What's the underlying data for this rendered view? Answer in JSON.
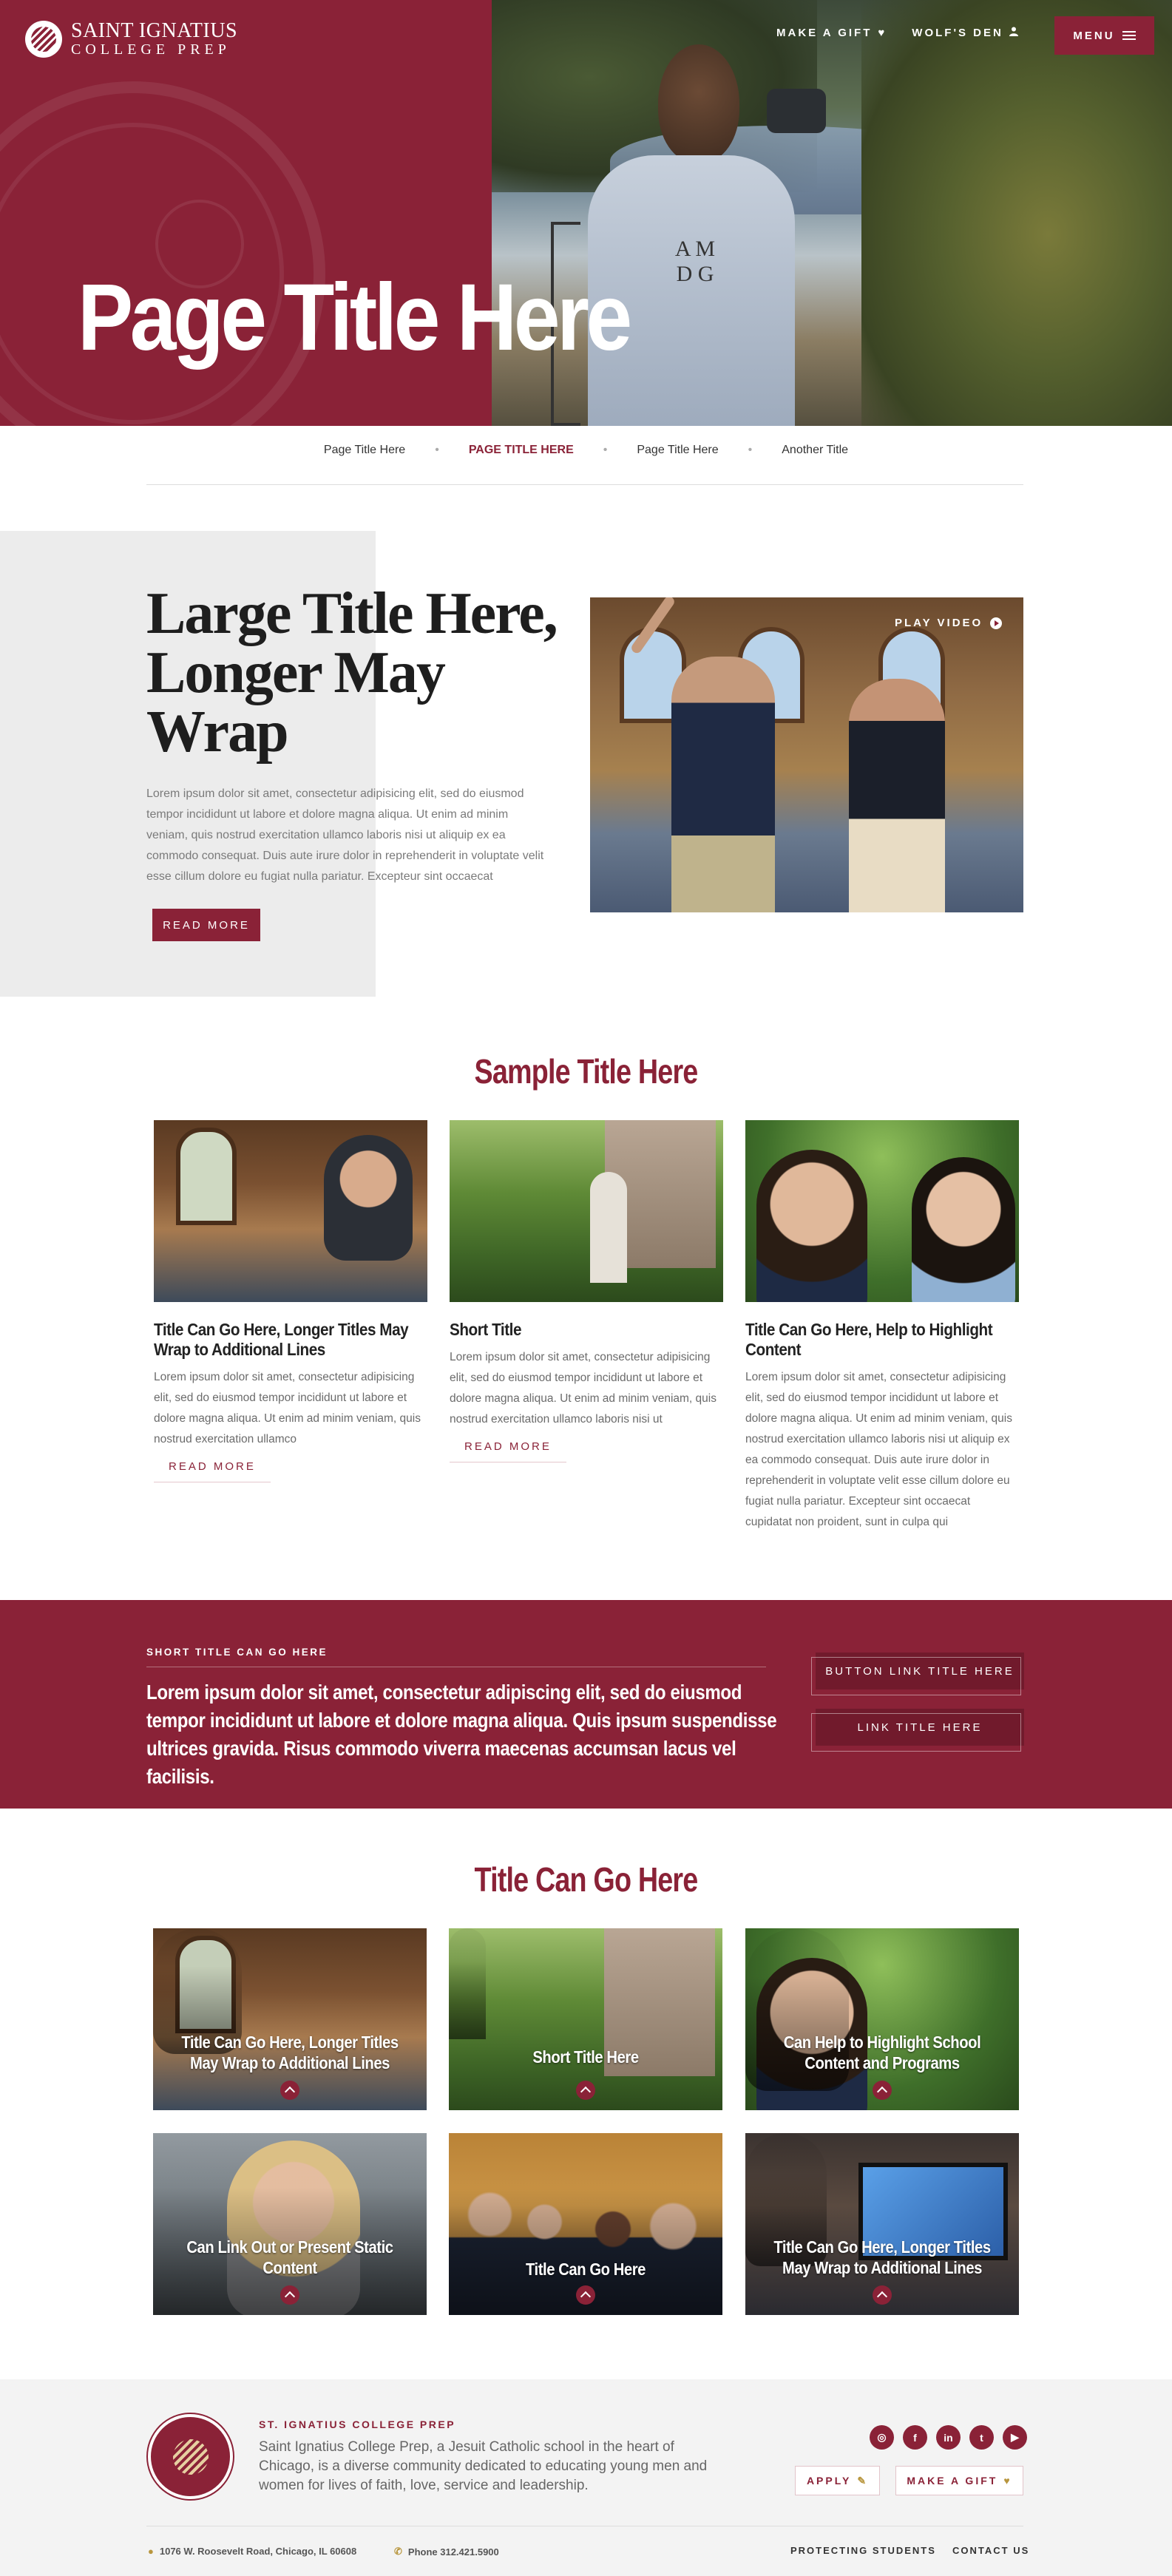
{
  "brand": {
    "line1": "SAINT IGNATIUS",
    "line2": "COLLEGE PREP",
    "accent": "#8a2237"
  },
  "top_nav": {
    "make_gift": "MAKE A GIFT",
    "make_gift_icon": "heart-icon",
    "wolfs_den": "WOLF'S DEN",
    "wolfs_den_icon": "user-icon",
    "menu": "MENU",
    "menu_icon": "hamburger-icon"
  },
  "hero": {
    "title": "Page Title Here",
    "shirt_text": "A M D G"
  },
  "breadcrumb": [
    {
      "label": "Page Title Here",
      "active": false
    },
    {
      "label": "PAGE TITLE HERE",
      "active": true
    },
    {
      "label": "Page Title Here",
      "active": false
    },
    {
      "label": "Another Title",
      "active": false
    }
  ],
  "intro": {
    "title": "Large Title Here, Longer May Wrap",
    "body": "Lorem ipsum dolor sit amet, consectetur adipisicing elit, sed do eiusmod tempor incididunt ut labore et dolore magna aliqua. Ut enim ad minim veniam, quis nostrud exercitation ullamco laboris nisi ut aliquip ex ea commodo consequat. Duis aute irure dolor in reprehenderit in voluptate velit esse cillum dolore eu fugiat nulla pariatur. Excepteur sint occaecat",
    "button": "READ MORE",
    "play_video": "PLAY VIDEO"
  },
  "sample_section": {
    "title": "Sample Title Here",
    "cards": [
      {
        "title": "Title Can Go Here, Longer Titles May Wrap to Additional Lines",
        "body": "Lorem ipsum dolor sit amet, consectetur adipisicing elit, sed do eiusmod tempor incididunt ut labore et dolore magna aliqua. Ut enim ad minim veniam, quis nostrud exercitation ullamco",
        "link": "READ MORE"
      },
      {
        "title": "Short Title",
        "body": "Lorem ipsum dolor sit amet, consectetur adipisicing elit, sed do eiusmod tempor incididunt ut labore et dolore magna aliqua. Ut enim ad minim veniam, quis nostrud exercitation ullamco laboris nisi ut",
        "link": "READ MORE"
      },
      {
        "title": "Title Can Go Here, Help to Highlight Content",
        "body": "Lorem ipsum dolor sit amet, consectetur adipisicing elit, sed do eiusmod tempor incididunt ut labore et dolore magna aliqua. Ut enim ad minim veniam, quis nostrud exercitation ullamco laboris nisi ut aliquip ex ea commodo consequat. Duis aute irure dolor in reprehenderit in voluptate velit esse cillum dolore eu fugiat nulla pariatur. Excepteur sint occaecat cupidatat non proident, sunt in culpa qui",
        "link": ""
      }
    ]
  },
  "band": {
    "eyebrow": "SHORT TITLE CAN GO HERE",
    "text": "Lorem ipsum dolor sit amet, consectetur adipiscing elit, sed do eiusmod tempor incididunt ut labore et dolore magna aliqua. Quis ipsum suspendisse ultrices gravida. Risus commodo viverra maecenas accumsan lacus vel facilisis.",
    "button1": "BUTTON LINK TITLE HERE",
    "button2": "LINK TITLE HERE"
  },
  "tiles_section": {
    "title": "Title Can Go Here",
    "tiles": [
      {
        "label": "Title Can Go Here, Longer Titles May Wrap to Additional Lines"
      },
      {
        "label": "Short Title Here"
      },
      {
        "label": "Can Help to Highlight School Content and Programs"
      },
      {
        "label": "Can Link Out or Present Static Content"
      },
      {
        "label": "Title Can Go Here"
      },
      {
        "label": "Title Can Go Here, Longer Titles May Wrap to Additional Lines"
      }
    ]
  },
  "footer": {
    "name": "ST. IGNATIUS COLLEGE PREP",
    "description": "Saint Ignatius College Prep, a Jesuit Catholic school in the heart of Chicago, is a diverse community dedicated to educating young men and women for lives of faith, love, service and leadership.",
    "social_icons": [
      "instagram-icon",
      "facebook-icon",
      "linkedin-icon",
      "twitter-icon",
      "youtube-icon"
    ],
    "social_glyphs": [
      "◎",
      "f",
      "in",
      "t",
      "▶"
    ],
    "apply": "APPLY",
    "make_gift": "MAKE A GIFT",
    "address": "1076 W. Roosevelt Road, Chicago, IL 60608",
    "phone": "Phone 312.421.5900",
    "link1": "PROTECTING STUDENTS",
    "link2": "CONTACT US"
  }
}
